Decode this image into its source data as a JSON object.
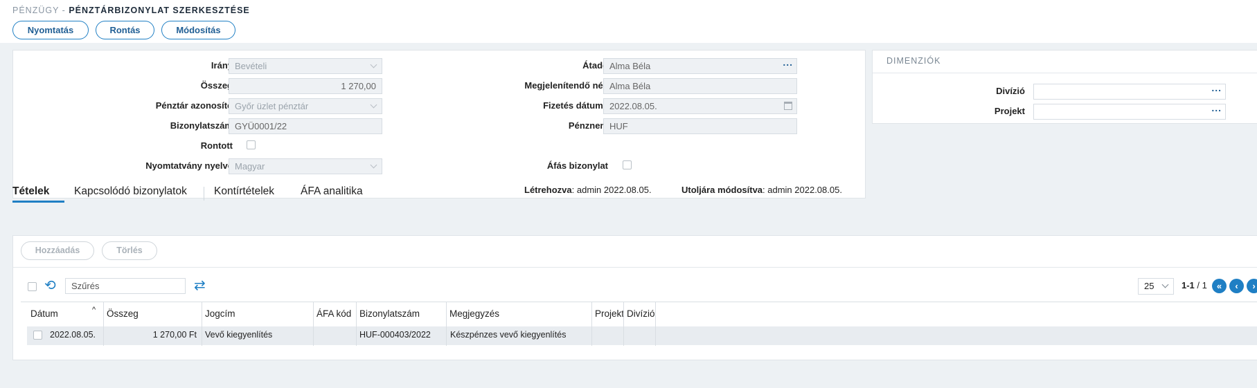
{
  "header": {
    "section": "PÉNZÜGY -",
    "title": "PÉNZTÁRBIZONYLAT SZERKESZTÉSE",
    "buttons": {
      "print": "Nyomtatás",
      "void": "Rontás",
      "modify": "Módosítás"
    }
  },
  "form": {
    "direction": {
      "label": "Irány",
      "value": "Bevételi"
    },
    "amount": {
      "label": "Összeg",
      "value": "1 270,00"
    },
    "cashdesk": {
      "label": "Pénztár azonosító",
      "value": "Győr üzlet pénztár"
    },
    "doc_number": {
      "label": "Bizonylatszám",
      "value": "GYÜ0001/22"
    },
    "voided": {
      "label": "Rontott"
    },
    "print_lang": {
      "label": "Nyomtatvány nyelve",
      "value": "Magyar"
    },
    "handed_over": {
      "label": "Átadó",
      "value": "Alma Béla"
    },
    "display_name": {
      "label": "Megjelenítendő név",
      "value": "Alma Béla"
    },
    "payment_date": {
      "label": "Fizetés dátuma",
      "value": "2022.08.05."
    },
    "currency": {
      "label": "Pénznem",
      "value": "HUF"
    },
    "vat_doc": {
      "label": "Áfás bizonylat"
    },
    "created_label": "Létrehozva",
    "created_value": ": admin 2022.08.05.",
    "modified_label": "Utoljára módosítva",
    "modified_value": ": admin 2022.08.05."
  },
  "dimensions": {
    "title": "DIMENZIÓK",
    "division_label": "Divízió",
    "project_label": "Projekt"
  },
  "tabs": [
    "Tételek",
    "Kapcsolódó bizonylatok",
    "Kontírtételek",
    "ÁFA analitika"
  ],
  "items": {
    "add_label": "Hozzáadás",
    "delete_label": "Törlés",
    "filter_value": "Szűrés",
    "page_size": "25",
    "page_range": "1-1",
    "page_total": " / 1",
    "columns": [
      "Dátum",
      "Összeg",
      "Jogcím",
      "ÁFA kód",
      "Bizonylatszám",
      "Megjegyzés",
      "Projekt",
      "Divízió"
    ],
    "rows": [
      {
        "date": "2022.08.05.",
        "amount": "1 270,00 Ft",
        "title": "Vevő kiegyenlítés",
        "vat": "",
        "doc": "HUF-000403/2022",
        "note": "Készpénzes vevő kiegyenlítés",
        "project": "",
        "division": ""
      }
    ]
  },
  "colors": {
    "accent": "#1f7fc4",
    "background": "#edf1f4"
  }
}
